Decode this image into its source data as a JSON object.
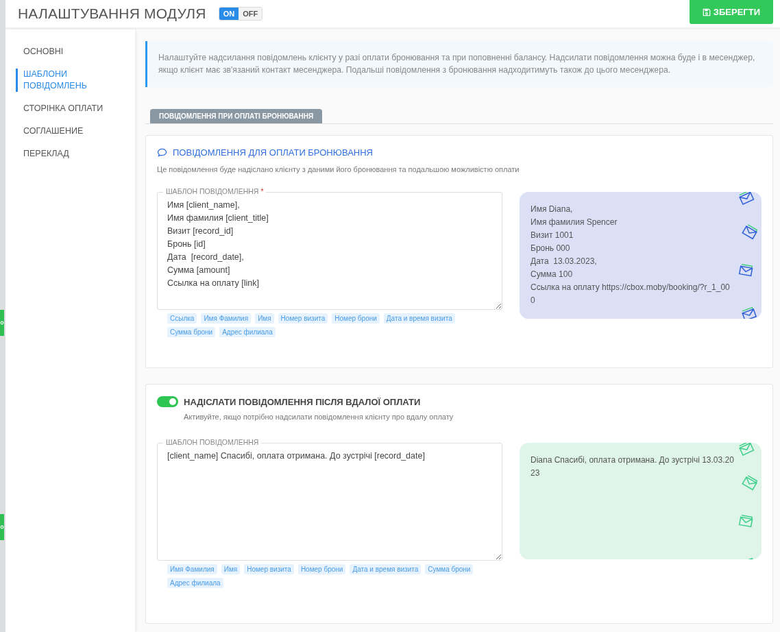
{
  "header": {
    "title": "НАЛАШТУВАННЯ МОДУЛЯ",
    "switch": [
      {
        "label": "ON",
        "selected": true
      },
      {
        "label": "OFF",
        "selected": false
      }
    ],
    "save_button": "ЗБЕРЕГТИ"
  },
  "sidebar": {
    "items": [
      {
        "label": "ОСНОВНІ",
        "selected": false
      },
      {
        "label": "ШАБЛОНИ ПОВІДОМЛЕНЬ",
        "selected": true
      },
      {
        "label": "СТОРІНКА ОПЛАТИ",
        "selected": false
      },
      {
        "label": "СОГЛАШЕНИЕ",
        "selected": false
      },
      {
        "label": "ПЕРЕКЛАД",
        "selected": false
      }
    ]
  },
  "info": "Налаштуйте надсилання повідомлень клієнту у разі оплати бронювання та при поповненні балансу. Надсилати повідомлення можна буде і в месенджер, якщо клієнт має зв'язаний контакт месенджера. Подальші повідомлення з бронювання надходитимуть також до цього месенджера.",
  "tabs": [
    {
      "label": "ПОВІДОМЛЕННЯ ПРИ ОПЛАТІ БРОНЮВАННЯ",
      "selected": true
    }
  ],
  "sections": [
    {
      "kind": "heading",
      "title": "ПОВІДОМЛЕННЯ ДЛЯ ОПЛАТИ БРОНЮВАННЯ",
      "description": "Це повідомлення буде надіслано клієнту з даними його бронювання та подальшою можливістю оплати",
      "template": {
        "label": "ШАБЛОН ПОВІДОМЛЕННЯ",
        "required_mark": "*",
        "value": "Имя [client_name],\nИмя фамилия [client_title]\nВизит [record_id]\nБронь [id]\nДата  [record_date],\nСумма [amount]\nСсылка на оплату [link]"
      },
      "tags": [
        "Ссылка",
        "Имя Фамилия",
        "Имя",
        "Номер визита",
        "Номер брони",
        "Дата и время визита",
        "Сумма брони",
        "Адрес филиала"
      ],
      "preview": {
        "text": "Имя Diana,\nИмя фамилия Spencer\nВизит 1001\nБронь 000\nДата  13.03.2023,\nСумма 100\nСсылка на оплату https://cbox.moby/booking/?r_1_000",
        "color": "#dbe0f7"
      }
    },
    {
      "kind": "toggle",
      "on": true,
      "title": "НАДІСЛАТИ ПОВІДОМЛЕННЯ ПІСЛЯ ВДАЛОЇ ОПЛАТИ",
      "description": "Активуйте, якщо потрібно надсилати повідомлення клієнту про вдалу оплату",
      "template": {
        "label": "ШАБЛОН ПОВІДОМЛЕННЯ",
        "value": "[client_name] Спасибі, оплата отримана. До зустрічі [record_date]"
      },
      "tags": [
        "Имя Фамилия",
        "Имя",
        "Номер визита",
        "Номер брони",
        "Дата и время визита",
        "Сумма брони",
        "Адрес филиала"
      ],
      "preview": {
        "text": "Diana Спасибі, оплата отримана. До зустрічі 13.03.2023",
        "color": "#dff5ea"
      }
    }
  ]
}
